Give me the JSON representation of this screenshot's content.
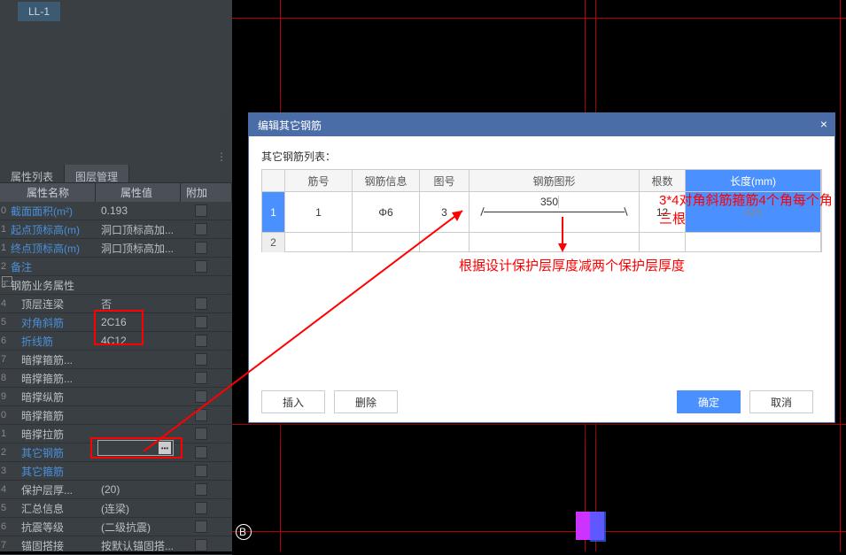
{
  "ll_tag": "LL-1",
  "tabs": {
    "t1": "属性列表",
    "t2": "图层管理"
  },
  "prop_header": {
    "name": "属性名称",
    "val": "属性值",
    "add": "附加"
  },
  "rows": [
    {
      "idx": "0",
      "name": "截面面积(m²)",
      "val": "0.193",
      "cls": "blue"
    },
    {
      "idx": "1",
      "name": "起点顶标高(m)",
      "val": "洞口顶标高加...",
      "cls": "blue"
    },
    {
      "idx": "1",
      "name": "终点顶标高(m)",
      "val": "洞口顶标高加...",
      "cls": "blue"
    },
    {
      "idx": "2",
      "name": "备注",
      "val": "",
      "cls": "blue"
    },
    {
      "idx": "3",
      "name": "钢筋业务属性",
      "val": "",
      "cls": "gray"
    },
    {
      "idx": "4",
      "name": "顶层连梁",
      "val": "否",
      "cls": "gray"
    },
    {
      "idx": "5",
      "name": "对角斜筋",
      "val": "2C16",
      "cls": "blue"
    },
    {
      "idx": "6",
      "name": "折线筋",
      "val": "4C12",
      "cls": "blue"
    },
    {
      "idx": "7",
      "name": "暗撑箍筋...",
      "val": "",
      "cls": "gray"
    },
    {
      "idx": "8",
      "name": "暗撑箍筋...",
      "val": "",
      "cls": "gray"
    },
    {
      "idx": "9",
      "name": "暗撑纵筋",
      "val": "",
      "cls": "gray"
    },
    {
      "idx": "0",
      "name": "暗撑箍筋",
      "val": "",
      "cls": "gray"
    },
    {
      "idx": "1",
      "name": "暗撑拉筋",
      "val": "",
      "cls": "gray"
    },
    {
      "idx": "2",
      "name": "其它钢筋",
      "val": "",
      "cls": "blue"
    },
    {
      "idx": "3",
      "name": "其它箍筋",
      "val": "",
      "cls": "blue"
    },
    {
      "idx": "4",
      "name": "保护层厚...",
      "val": "(20)",
      "cls": "gray"
    },
    {
      "idx": "5",
      "name": "汇总信息",
      "val": "(连梁)",
      "cls": "gray"
    },
    {
      "idx": "6",
      "name": "抗震等级",
      "val": "(二级抗震)",
      "cls": "gray"
    },
    {
      "idx": "7",
      "name": "锚固搭接",
      "val": "按默认锚固搭...",
      "cls": "gray"
    }
  ],
  "dialog": {
    "title": "编辑其它钢筋",
    "list_label": "其它钢筋列表：",
    "headers": {
      "h1": "筋号",
      "h2": "钢筋信息",
      "h3": "图号",
      "h4": "钢筋图形",
      "h5": "根数",
      "h6": "长度(mm)"
    },
    "row1": {
      "idx": "1",
      "c1": "1",
      "c2": "Φ6",
      "c3": "3",
      "shape_val": "350",
      "c5": "12",
      "c6": "425"
    },
    "row2_idx": "2",
    "btns": {
      "insert": "插入",
      "delete": "删除",
      "ok": "确定",
      "cancel": "取消"
    }
  },
  "annos": {
    "a1": "3*4对角斜筋箍筋4个角每个角三根",
    "a2": "根据设计保护层厚度减两个保护层厚度"
  },
  "b_label": "B"
}
